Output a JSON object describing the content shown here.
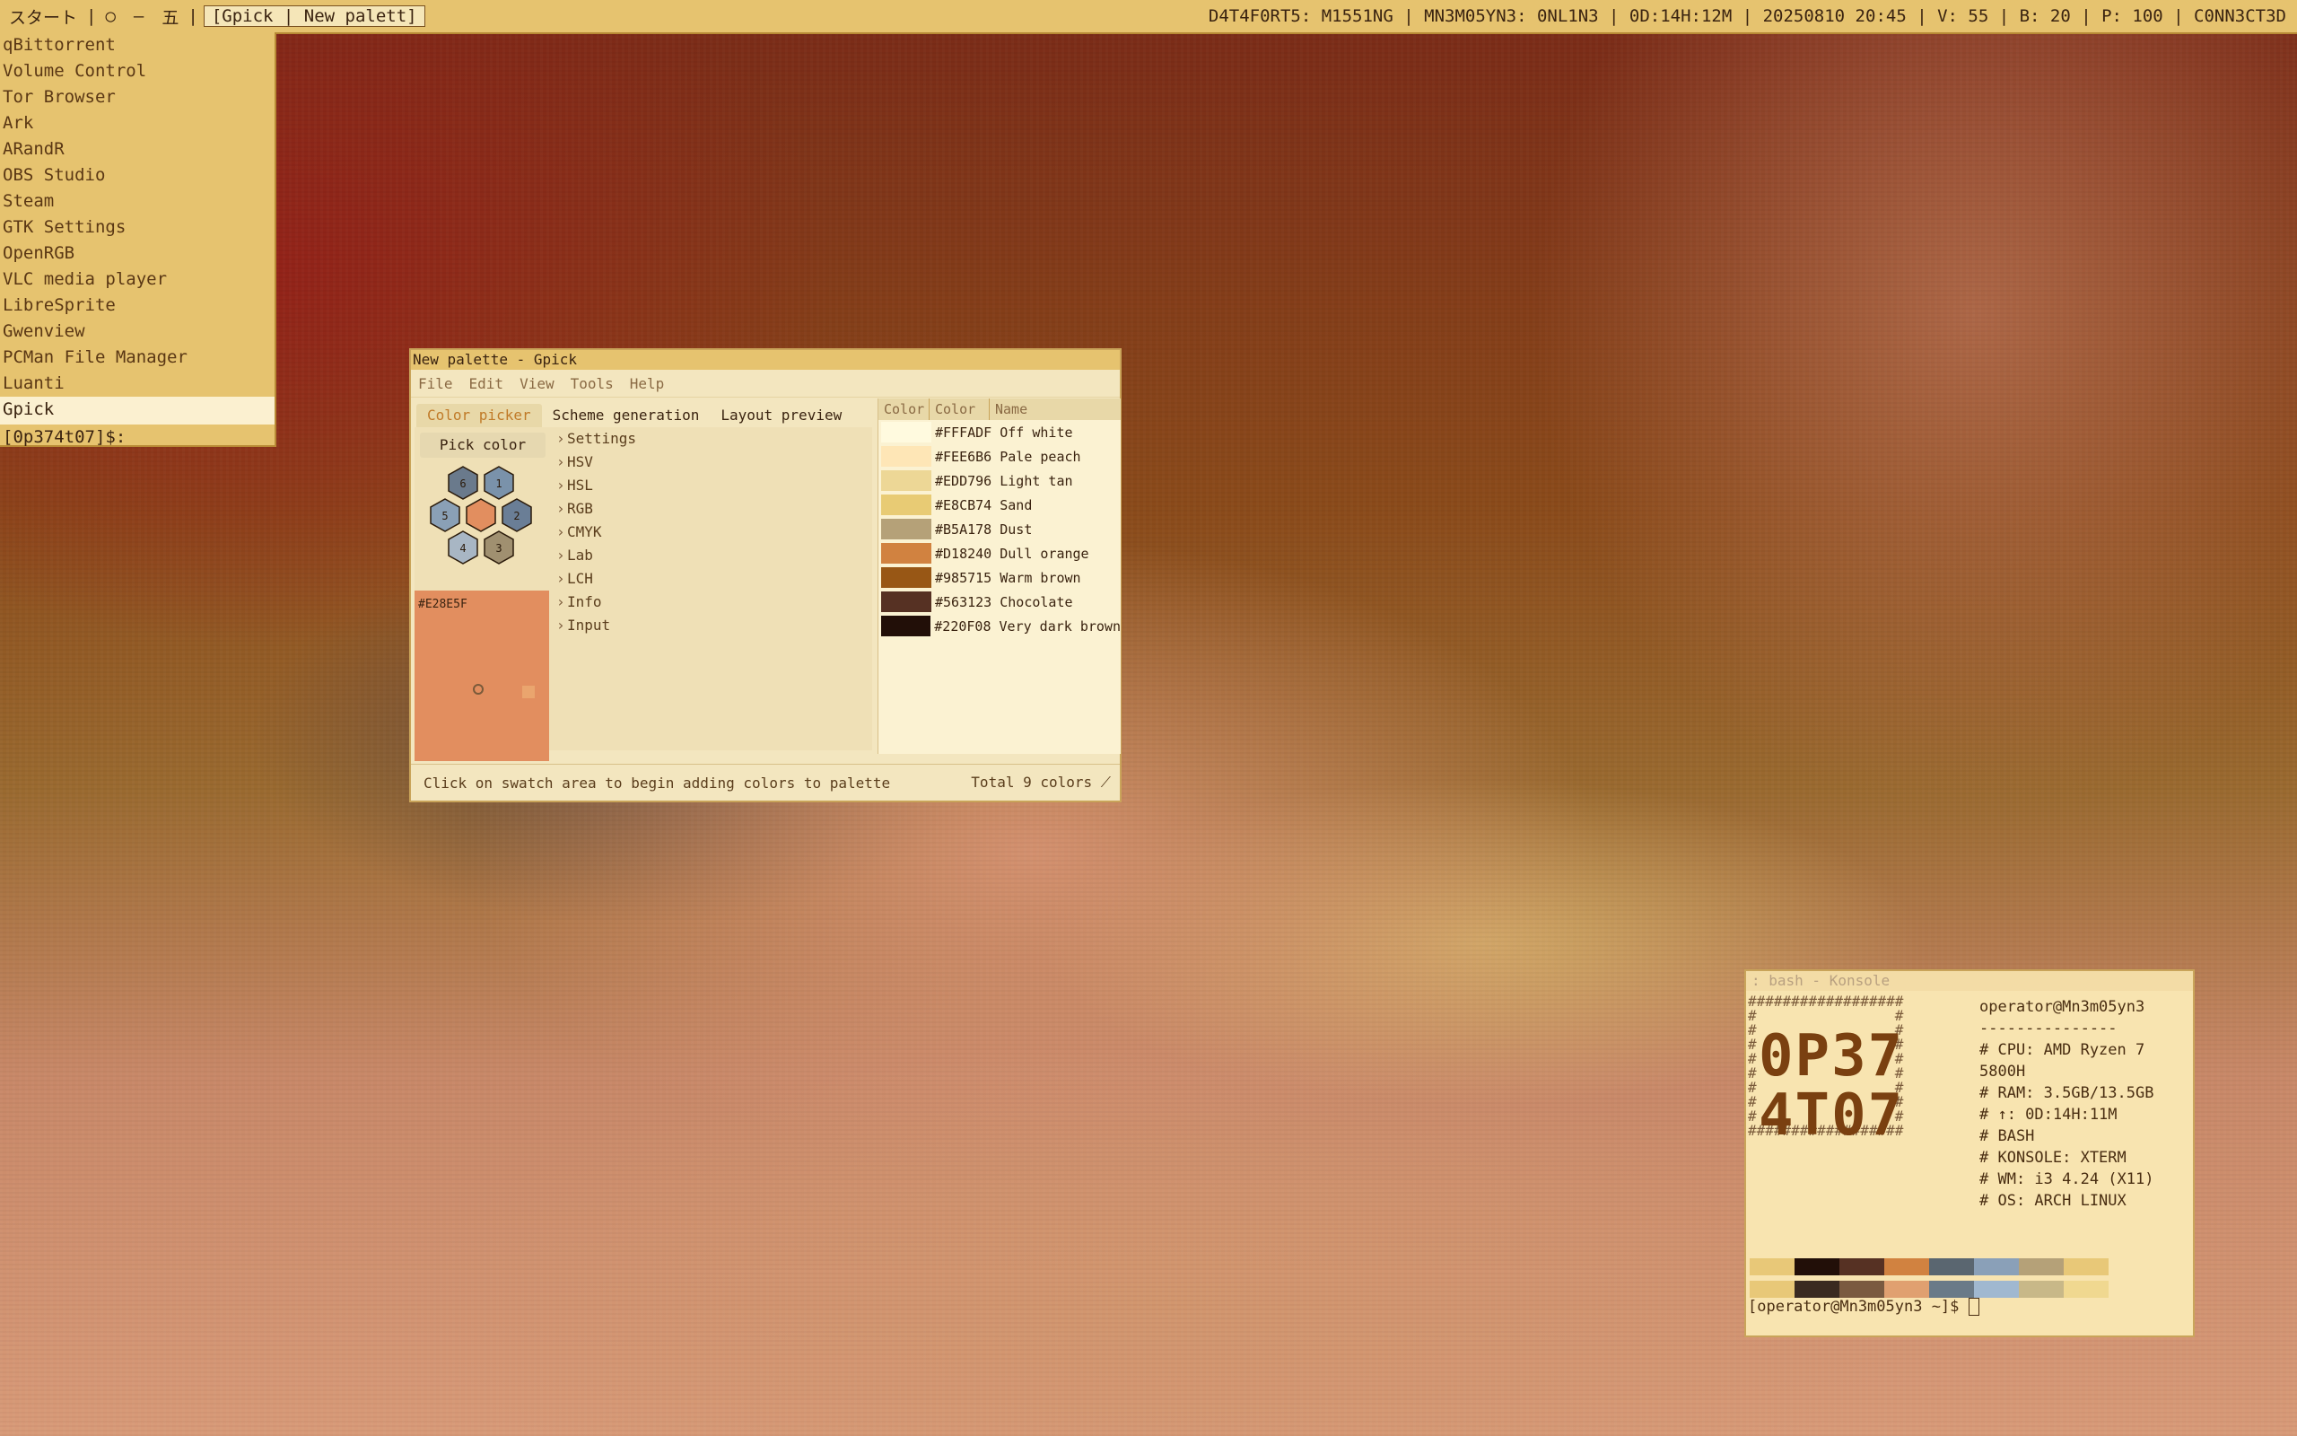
{
  "topbar": {
    "start": "スタート",
    "sep": "|",
    "circle": "○",
    "dash": "—",
    "five": "五",
    "workspace": "[Gpick | New palett]",
    "status": "D4T4F0RT5: M1551NG | MN3M05YN3: 0NL1N3 | 0D:14H:12M | 20250810 20:45 | V: 55 | B: 20 | P: 100 | C0NN3CT3D"
  },
  "launcher": {
    "items": [
      "qBittorrent",
      "Volume Control",
      "Tor Browser",
      "Ark",
      "ARandR",
      "OBS Studio",
      "Steam",
      "GTK Settings",
      "OpenRGB",
      "VLC media player",
      "LibreSprite",
      "Gwenview",
      "PCMan File Manager",
      "Luanti",
      "Gpick"
    ],
    "selected": "Gpick",
    "prompt": "[0p374t07]$:"
  },
  "gpick": {
    "title": "New palette - Gpick",
    "menu": [
      "File",
      "Edit",
      "View",
      "Tools",
      "Help"
    ],
    "tabs": [
      "Color picker",
      "Scheme generation",
      "Layout preview"
    ],
    "active_tab": "Color picker",
    "pick_button": "Pick color",
    "hex_labels": [
      "6",
      "1",
      "5",
      "2",
      "4",
      "3"
    ],
    "swatch_hex": "#E28E5F",
    "tree": [
      "Settings",
      "HSV",
      "HSL",
      "RGB",
      "CMYK",
      "Lab",
      "LCH",
      "Info",
      "Input"
    ],
    "palette_headers": [
      "Color",
      "Color",
      "Name"
    ],
    "palette": [
      {
        "hex": "#FFFADF",
        "name": "Off white"
      },
      {
        "hex": "#FEE6B6",
        "name": "Pale peach"
      },
      {
        "hex": "#EDD796",
        "name": "Light tan"
      },
      {
        "hex": "#E8CB74",
        "name": "Sand"
      },
      {
        "hex": "#B5A178",
        "name": "Dust"
      },
      {
        "hex": "#D18240",
        "name": "Dull orange"
      },
      {
        "hex": "#985715",
        "name": "Warm brown"
      },
      {
        "hex": "#563123",
        "name": "Chocolate"
      },
      {
        "hex": "#220F08",
        "name": "Very dark brown"
      }
    ],
    "status_left": "Click on swatch area to begin adding colors to palette",
    "status_right": "Total 9 colors"
  },
  "konsole": {
    "title": ": bash - Konsole",
    "big_line1": "0P37",
    "big_line2": "4T07",
    "info": [
      "operator@Mn3m05yn3",
      "---------------",
      "# CPU: AMD Ryzen 7 5800H",
      "# RAM: 3.5GB/13.5GB",
      "# ↑: 0D:14H:11M",
      "# BASH",
      "# KONSOLE: XTERM",
      "# WM: i3 4.24 (X11)",
      "# OS: ARCH LINUX"
    ],
    "colors_row1": [
      "#e8c878",
      "#220f08",
      "#563123",
      "#d18240",
      "#5a6670",
      "#8aa0b8",
      "#b5a178",
      "#e8c878"
    ],
    "colors_row2": [
      "#e8c878",
      "#3a2a20",
      "#7a5a40",
      "#e0a070",
      "#6a7a88",
      "#a0b8d0",
      "#c8b888",
      "#f0d890"
    ],
    "prompt": "[operator@Mn3m05yn3 ~]$ "
  }
}
